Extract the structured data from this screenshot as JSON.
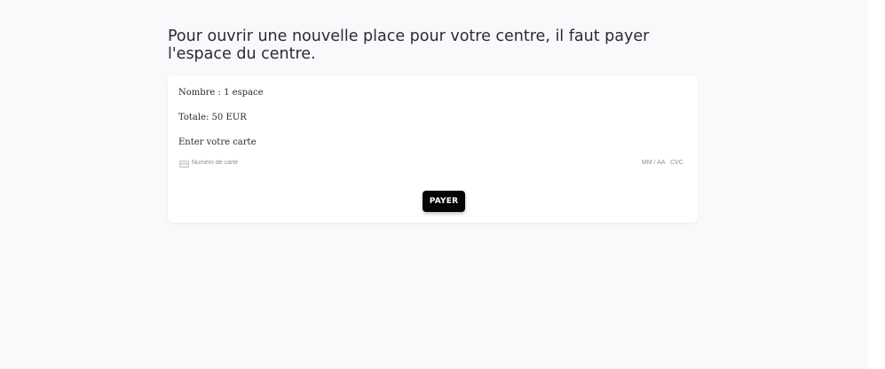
{
  "page": {
    "title": "Pour ouvrir une nouvelle place pour votre centre, il faut payer l'espace du centre."
  },
  "payment_card": {
    "quantity_line": "Nombre : 1 espace",
    "total_line": "Totale: 50 EUR",
    "card_prompt": "Enter votre carte",
    "card_input": {
      "number_placeholder": "Numéro de carte",
      "expiry_placeholder": "MM / AA",
      "cvc_placeholder": "CVC",
      "icon": "credit-card-icon"
    },
    "pay_button_label": "PAYER"
  },
  "colors": {
    "background": "#f8f9fb",
    "card_background": "#ffffff",
    "button_background": "#050505",
    "button_text": "#ffffff",
    "title_text": "#2a2c33",
    "placeholder_text": "#8a8f98"
  }
}
